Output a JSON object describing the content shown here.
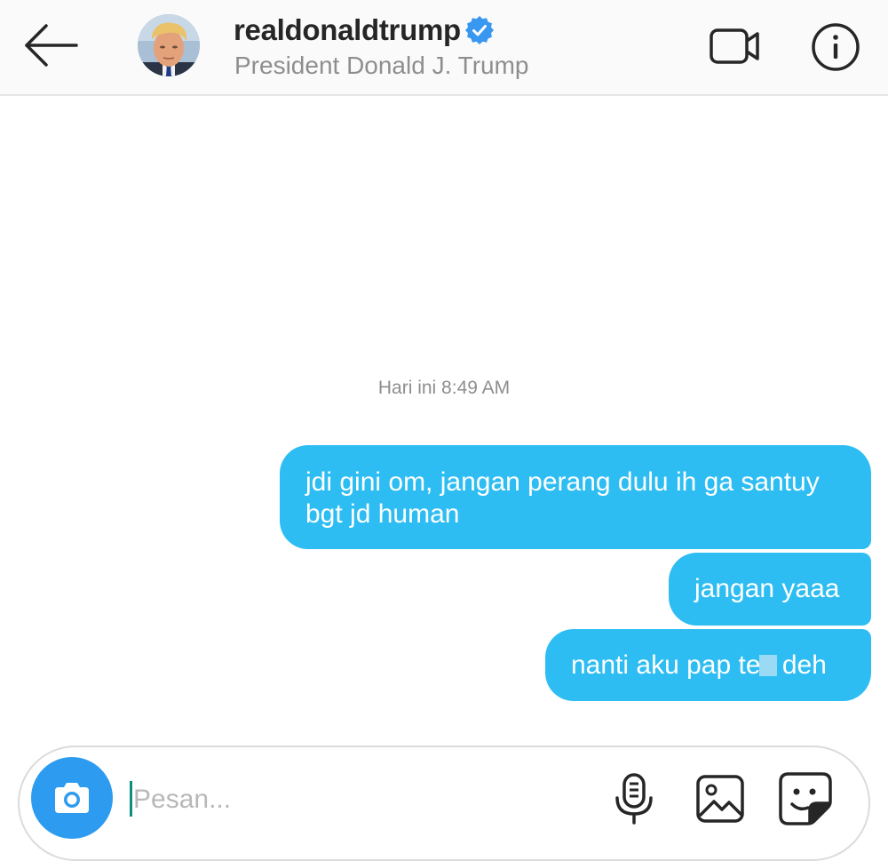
{
  "header": {
    "back_icon": "arrow-left-icon",
    "username": "realdonaldtrump",
    "verified": true,
    "verified_color": "#3897f0",
    "full_name": "President Donald J. Trump",
    "video_call_icon": "video-camera-icon",
    "info_icon": "info-icon"
  },
  "conversation": {
    "timestamp": "Hari ini 8:49 AM",
    "bubble_color": "#2ebdf2",
    "messages": [
      {
        "text": "jdi gini om, jangan perang dulu ih ga santuy bgt jd human",
        "sender": "me"
      },
      {
        "text": "jangan yaaa",
        "sender": "me"
      },
      {
        "text_before": "nanti aku pap te",
        "text_after": "deh",
        "sender": "me",
        "censored": true
      }
    ]
  },
  "composer": {
    "camera_icon": "camera-icon",
    "camera_color": "#2d9cf0",
    "placeholder": "Pesan...",
    "value": "",
    "mic_icon": "microphone-icon",
    "gallery_icon": "image-icon",
    "sticker_icon": "sticker-icon"
  }
}
